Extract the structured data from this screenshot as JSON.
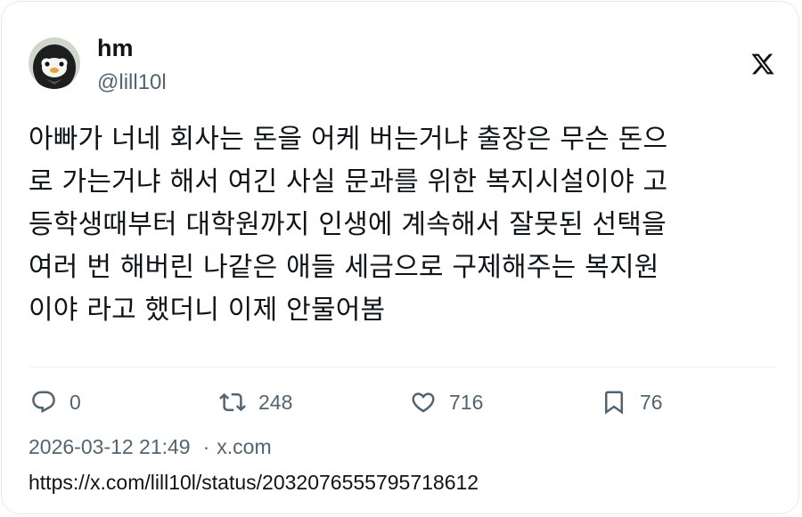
{
  "author": {
    "name": "hm",
    "handle": "@lill10l",
    "avatar_icon": "penguin-avatar-icon"
  },
  "platform_icon": "x-logo-icon",
  "tweet": {
    "lines": [
      "아빠가 너네 회사는 돈을 어케 버는거냐 출장은 무슨 돈으",
      "로 가는거냐 해서 여긴 사실 문과를 위한 복지시설이야 고",
      "등학생때부터 대학원까지 인생에 계속해서 잘못된 선택을",
      "여러 번 해버린 나같은 애들 세금으로 구제해주는 복지원",
      "이야 라고 했더니 이제 안물어봄"
    ]
  },
  "actions": {
    "reply": {
      "icon": "reply-icon",
      "count": "0"
    },
    "retweet": {
      "icon": "retweet-icon",
      "count": "248"
    },
    "like": {
      "icon": "heart-icon",
      "count": "716"
    },
    "bookmark": {
      "icon": "bookmark-icon",
      "count": "76"
    }
  },
  "meta": {
    "timestamp": "2026-03-12 21:49",
    "separator": "·",
    "source": "x.com"
  },
  "url": "https://x.com/lill10l/status/2032076555795718612",
  "colors": {
    "text": "#0f1419",
    "secondary": "#536471",
    "border": "#e6e9ec"
  }
}
